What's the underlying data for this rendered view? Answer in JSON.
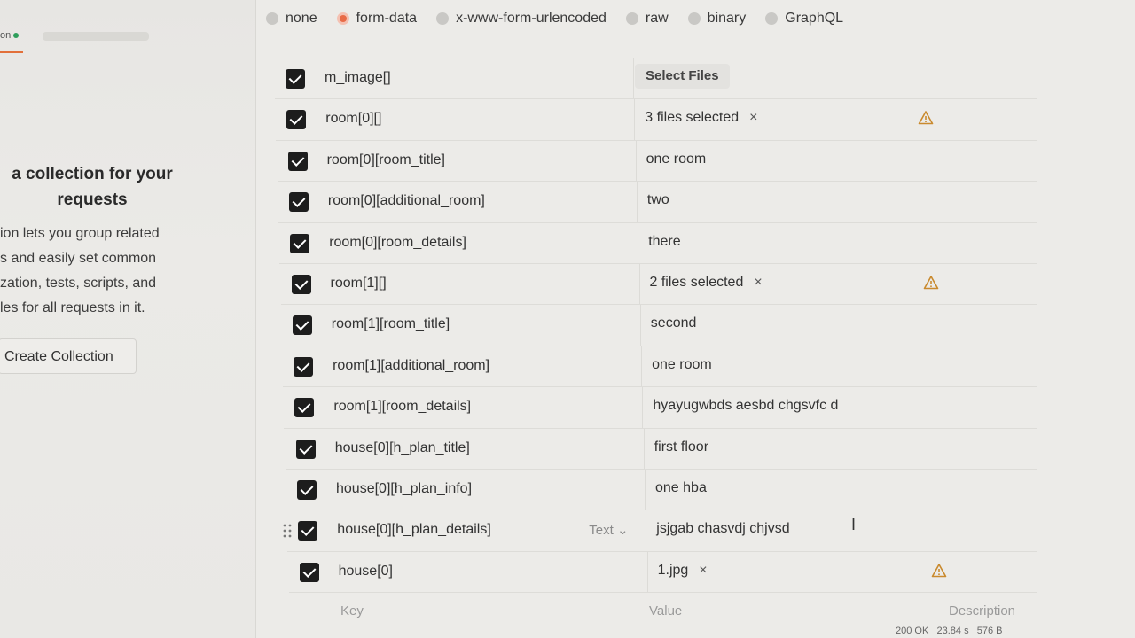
{
  "sidebar": {
    "top_label": "on",
    "title_line1": "a collection for your",
    "title_line2": "requests",
    "desc_lines": [
      "ion lets you group related",
      "s and easily set common",
      "zation, tests, scripts, and",
      "les for all requests in it."
    ],
    "create_button": "Create Collection"
  },
  "body_types": [
    {
      "label": "none",
      "active": false
    },
    {
      "label": "form-data",
      "active": true
    },
    {
      "label": "x-www-form-urlencoded",
      "active": false
    },
    {
      "label": "raw",
      "active": false
    },
    {
      "label": "binary",
      "active": false
    },
    {
      "label": "GraphQL",
      "active": false
    }
  ],
  "rows": [
    {
      "key": "m_image[]",
      "value": "",
      "select_files": "Select Files"
    },
    {
      "key": "room[0][]",
      "value": "3 files selected",
      "remove": "×",
      "warn": true
    },
    {
      "key": "room[0][room_title]",
      "value": "one room"
    },
    {
      "key": "room[0][additional_room]",
      "value": "two"
    },
    {
      "key": "room[0][room_details]",
      "value": "there"
    },
    {
      "key": "room[1][]",
      "value": "2 files selected",
      "remove": "×",
      "warn": true
    },
    {
      "key": "room[1][room_title]",
      "value": "second"
    },
    {
      "key": "room[1][additional_room]",
      "value": "one room"
    },
    {
      "key": "room[1][room_details]",
      "value": "hyayugwbds aesbd chgsvfc d"
    },
    {
      "key": "house[0][h_plan_title]",
      "value": "first floor"
    },
    {
      "key": "house[0][h_plan_info]",
      "value": "one hba"
    },
    {
      "key": "house[0][h_plan_details]",
      "value": "jsjgab chasvdj chjvsd",
      "type_select": "Text ⌄",
      "hovered": true
    },
    {
      "key": "house[0]",
      "value": "1.jpg",
      "remove": "×",
      "warn": true
    }
  ],
  "placeholders": {
    "key": "Key",
    "value": "Value",
    "description": "Description"
  },
  "status": {
    "code": "200 OK",
    "time": "23.84 s",
    "size": "576 B"
  },
  "colors": {
    "accent": "#e86b47",
    "check": "#1d1d1d",
    "warn": "#c98a2e",
    "status_dot": "#2f9e5b"
  }
}
